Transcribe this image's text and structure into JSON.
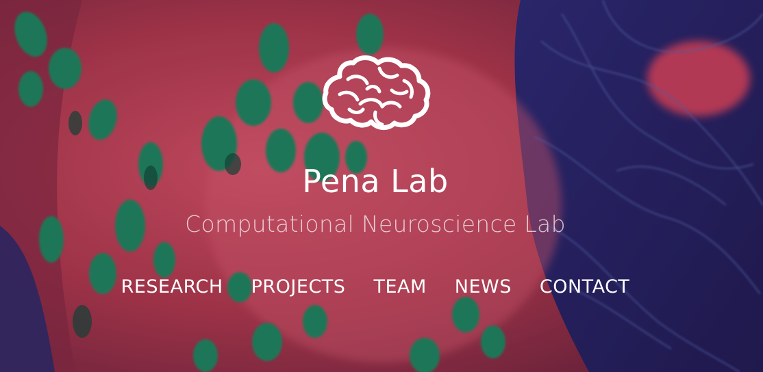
{
  "site": {
    "title": "Pena Lab",
    "subtitle": "Computational Neuroscience Lab",
    "logo_icon": "brain-icon"
  },
  "nav": {
    "items": [
      {
        "label": "RESEARCH"
      },
      {
        "label": "PROJECTS"
      },
      {
        "label": "TEAM"
      },
      {
        "label": "NEWS"
      },
      {
        "label": "CONTACT"
      }
    ]
  },
  "colors": {
    "text": "#ffffff",
    "subtitle": "#d8c9d6",
    "bg_red": "#b83a4e",
    "bg_green": "#1f8a5e",
    "bg_navy": "#2a2470"
  }
}
